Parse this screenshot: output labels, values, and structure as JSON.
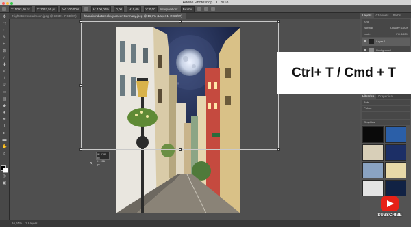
{
  "window": {
    "title": "Adobe Photoshop CC 2018"
  },
  "options_bar": {
    "fields": [
      "X: 1093,00 px",
      "Y: 1053,50 px",
      "W: 100,00%",
      "H: 100,00%",
      "0,00",
      "H: 0,00",
      "V: 0,00"
    ],
    "interpolation_label": "Interpolation:",
    "interpolation_value": "Bicubic"
  },
  "tabs": [
    {
      "label": "Nightstreetcloudmoon.jpeg @ 33,3% (RGB/8#)",
      "active": false
    },
    {
      "label": "haoneixinduitreeclouyumeer-Germany.jpeg @ 16,7% (Layer 1, RGB/8#)",
      "active": true
    }
  ],
  "tooltip": {
    "w": "W: 1792 px",
    "h": "H: 1962 px"
  },
  "status": {
    "zoom": "16,67%",
    "doc": "2 Layers"
  },
  "caption": "Ctrl+ T / Cmd + T",
  "layers_panel": {
    "tabs": [
      "Layers",
      "Channels",
      "Paths"
    ],
    "kind": "Kind",
    "blend": "Normal",
    "opacity_label": "Opacity:",
    "opacity_value": "100%",
    "lock_label": "Lock:",
    "fill_label": "Fill:",
    "fill_value": "100%",
    "layers": [
      "Layer 1",
      "Background"
    ]
  },
  "libraries_panel": {
    "tabs": [
      "Libraries",
      "Properties"
    ],
    "search": "Bob",
    "colors_header": "Colors",
    "graphics_header": "Graphics"
  },
  "youtube": {
    "label": "SUBSCRIBE",
    "color": "#e62117"
  }
}
